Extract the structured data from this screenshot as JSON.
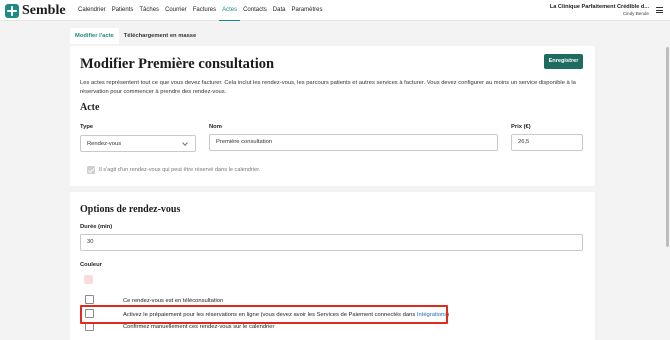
{
  "app": {
    "logo_text": "Semble",
    "nav": [
      {
        "label": "Calendrier"
      },
      {
        "label": "Patients"
      },
      {
        "label": "Tâches"
      },
      {
        "label": "Courrier"
      },
      {
        "label": "Factures"
      },
      {
        "label": "Actes"
      },
      {
        "label": "Contacts"
      },
      {
        "label": "Data"
      },
      {
        "label": "Paramètres"
      }
    ],
    "active_nav": "Actes",
    "clinic_name": "La Clinique Parfaitement Crédible d...",
    "user_name": "Cindy Bende"
  },
  "tabs": [
    {
      "label": "Modifier l'acte"
    },
    {
      "label": "Téléchargement en masse"
    }
  ],
  "page": {
    "title": "Modifier Première consultation",
    "save_label": "Enregistrer",
    "description": "Les actes représentent tout ce que vous devez facturer. Cela inclut les rendez-vous, les parcours patients et autres services à facturer. Vous devez configurer au moins un service disponible à la réservation pour commencer à prendre des rendez-vous."
  },
  "acte": {
    "heading": "Acte",
    "type_label": "Type",
    "type_value": "Rendez-vous",
    "name_label": "Nom",
    "name_value": "Première consultation",
    "price_label": "Prix (€)",
    "price_value": "26,5",
    "appointment_note": "Il s'agit d'un rendez-vous qui peut être réservé dans le calendrier."
  },
  "options": {
    "heading": "Options de rendez-vous",
    "duration_label": "Durée (min)",
    "duration_value": "30",
    "color_label": "Couleur",
    "color_value": "#f8dcdf",
    "teleconsult_label": "Ce rendez-vous est en téléconsultation",
    "prepayment_label": "Activez le prépaiement pour les réservations en ligne (vous devez avoir les Services de Paiement connectés dans ",
    "prepayment_link": "Intégrations",
    "prepayment_suffix": ")",
    "manual_confirm_label": "Confirmez manuellement ces rendez-vous sur le calendrier"
  },
  "colors": {
    "brand": "#1e8a83",
    "primary_button": "#1e6b60",
    "highlight": "#e02a1c",
    "link": "#1e6fb0"
  }
}
